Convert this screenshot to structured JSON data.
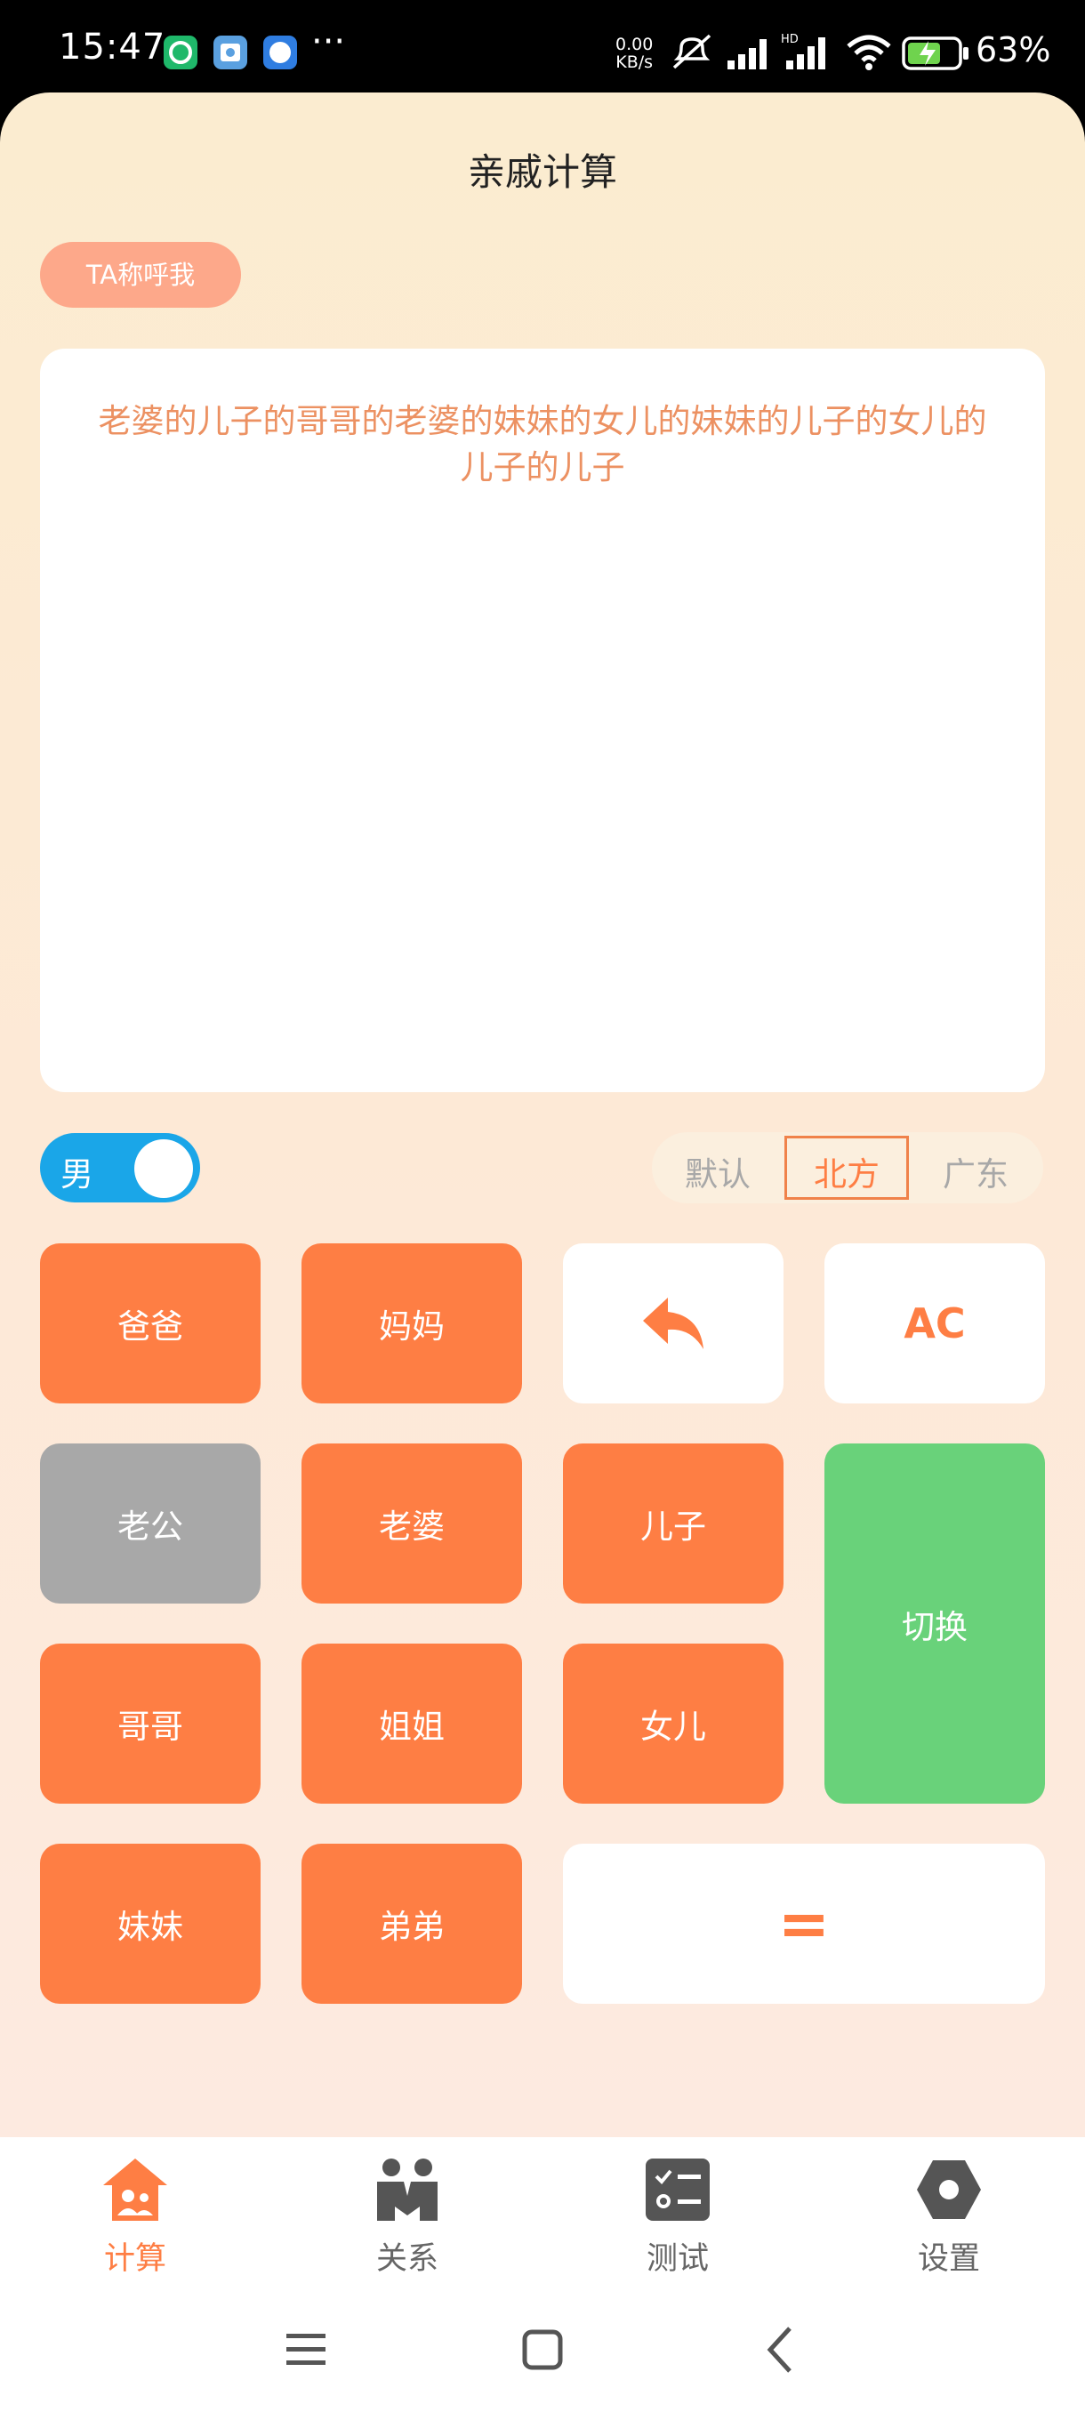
{
  "status_bar": {
    "time": "15:47",
    "more": "···",
    "net_speed_value": "0.00",
    "net_speed_unit": "KB/s",
    "battery": "63%",
    "icons": [
      "app-green-icon",
      "app-blue-icon",
      "app-compass-icon",
      "mute-icon",
      "signal-icon",
      "hd-signal-icon",
      "wifi-icon",
      "battery-icon"
    ]
  },
  "header": {
    "title": "亲戚计算"
  },
  "mode_pill": {
    "label": "TA称呼我"
  },
  "result": {
    "text": "老婆的儿子的哥哥的老婆的妹妹的女儿的妹妹的儿子的女儿的儿子的儿子"
  },
  "gender_toggle": {
    "label": "男",
    "on": true
  },
  "dialect": {
    "options": [
      "默认",
      "北方",
      "广东"
    ],
    "selected": "北方"
  },
  "keypad": {
    "dad": "爸爸",
    "mom": "妈妈",
    "back_icon": "reply-icon",
    "clear": "AC",
    "husband": "老公",
    "wife": "老婆",
    "son": "儿子",
    "switch": "切换",
    "older_brother": "哥哥",
    "older_sister": "姐姐",
    "daughter": "女儿",
    "younger_sister": "妹妹",
    "younger_brother": "弟弟",
    "equals": "="
  },
  "colors": {
    "accent": "#fe7e44",
    "disabled": "#a8a8a8",
    "green": "#69d27a",
    "toggle": "#1aa6e8",
    "result_text": "#ec9162"
  },
  "bottom_nav": [
    {
      "label": "计算",
      "icon": "home-family-icon",
      "active": true
    },
    {
      "label": "关系",
      "icon": "people-icon",
      "active": false
    },
    {
      "label": "测试",
      "icon": "checklist-icon",
      "active": false
    },
    {
      "label": "设置",
      "icon": "hexagon-settings-icon",
      "active": false
    }
  ]
}
